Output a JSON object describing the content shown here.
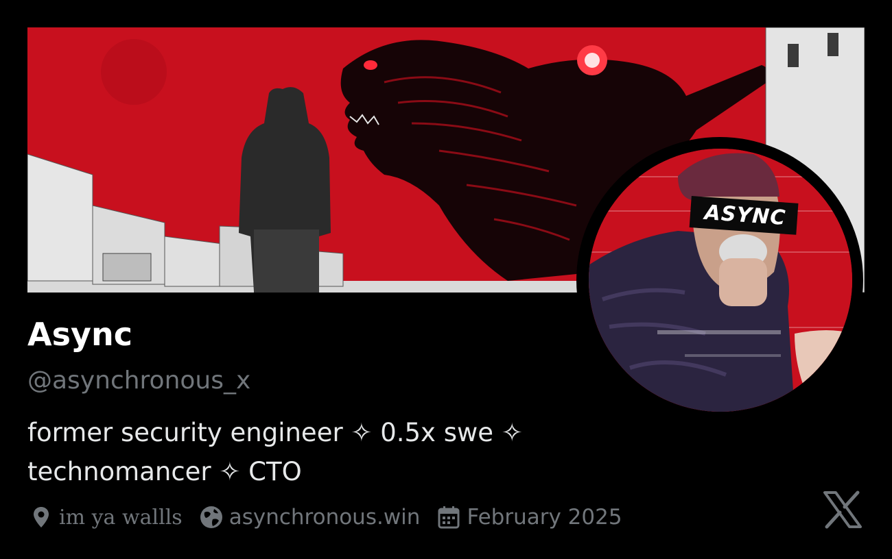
{
  "profile": {
    "display_name": "Async",
    "handle": "@asynchronous_x",
    "bio_lines": [
      "former security engineer ✧ 0.5x swe ✧",
      "technomancer ✧ CTO"
    ],
    "location": "im ya wallls",
    "website": "asynchronous.win",
    "joined": "February 2025",
    "avatar_text": "ASYNC"
  },
  "icons": {
    "location": "location-pin-icon",
    "website": "globe-icon",
    "joined": "calendar-icon",
    "brand": "x-logo-icon"
  },
  "colors": {
    "background": "#000000",
    "banner_red": "#c8101e",
    "text_primary": "#e7e9ea",
    "text_secondary": "#71767b",
    "display_name": "#ffffff"
  }
}
